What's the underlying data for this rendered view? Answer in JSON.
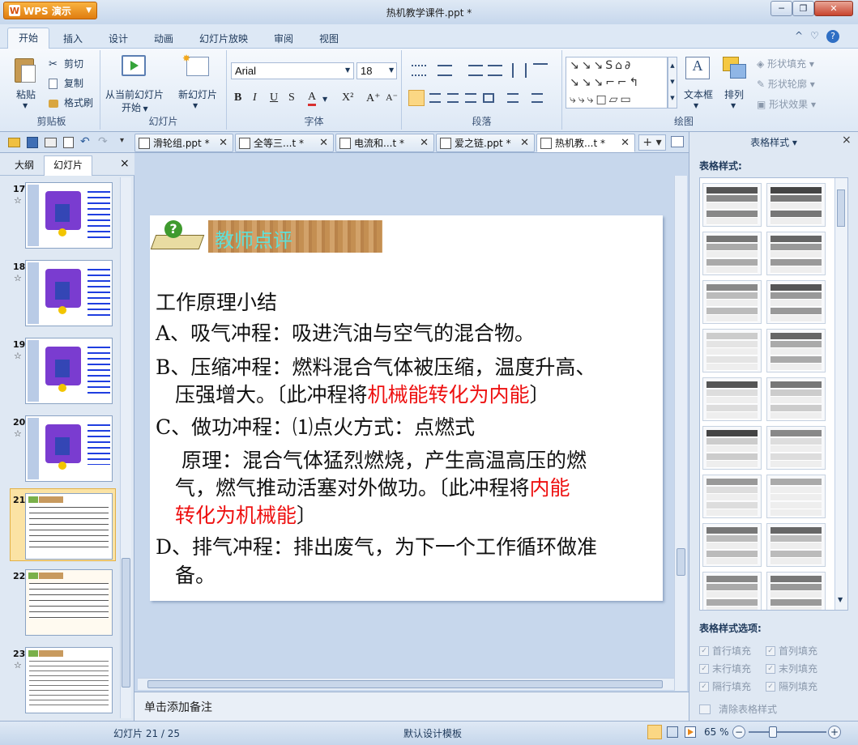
{
  "app": {
    "name": "WPS 演示",
    "title": "热机教学课件.ppt *"
  },
  "window_controls": {
    "minimize": "─",
    "restore": "❐",
    "close": "✕"
  },
  "menu": {
    "tabs": [
      "开始",
      "插入",
      "设计",
      "动画",
      "幻灯片放映",
      "审阅",
      "视图"
    ],
    "right_icons": [
      "^",
      "♡",
      "?"
    ]
  },
  "ribbon": {
    "clipboard": {
      "label": "剪贴板",
      "paste": "粘贴",
      "cut": "剪切",
      "copy": "复制",
      "format_painter": "格式刷"
    },
    "slides": {
      "label": "幻灯片",
      "from_current": "从当前幻灯片",
      "start": "开始",
      "new_slide": "新幻灯片"
    },
    "font": {
      "label": "字体",
      "family": "Arial",
      "size": "18",
      "bold": "B",
      "italic": "I",
      "underline": "U",
      "shadow": "S",
      "color": "A",
      "superscript": "X²",
      "grow": "A⁺",
      "shrink": "A⁻"
    },
    "paragraph": {
      "label": "段落"
    },
    "drawing": {
      "label": "绘图",
      "textbox": "文本框",
      "arrange": "排列",
      "shape_fill": "形状填充",
      "shape_outline": "形状轮廓",
      "shape_effect": "形状效果"
    }
  },
  "doc_tabs": [
    {
      "label": "滑轮组.ppt *"
    },
    {
      "label": "全等三...t *"
    },
    {
      "label": "电流和...t *"
    },
    {
      "label": "爱之链.ppt *"
    },
    {
      "label": "热机教...t *",
      "active": true
    }
  ],
  "left_panel": {
    "tab_outline": "大纲",
    "tab_slides": "幻灯片",
    "close": "×",
    "slides": [
      {
        "num": "17",
        "star": "☆"
      },
      {
        "num": "18",
        "star": "☆"
      },
      {
        "num": "19",
        "star": "☆"
      },
      {
        "num": "20",
        "star": "☆"
      },
      {
        "num": "21",
        "star": "",
        "selected": true
      },
      {
        "num": "22",
        "star": ""
      },
      {
        "num": "23",
        "star": "☆"
      }
    ]
  },
  "slide": {
    "header": "教师点评",
    "heading": "工作原理小结",
    "line_a": "A、吸气冲程：吸进汽油与空气的混合物。",
    "line_b1": "B、压缩冲程：燃料混合气体被压缩，温度升高、",
    "line_b2_pre": "压强增大。〔此冲程将",
    "line_b2_red": "机械能转化为内能",
    "line_b2_post": "〕",
    "line_c1": "C、做功冲程：⑴点火方式：点燃式",
    "line_c2": "原理：混合气体猛烈燃烧，产生高温高压的燃",
    "line_c3_pre": "气，燃气推动活塞对外做功。〔此冲程将",
    "line_c3_red": "内能",
    "line_c4_red": "转化为机械能",
    "line_c4_post": "〕",
    "line_d1": "D、排气冲程：排出废气，为下一个工作循环做准",
    "line_d2": "备。"
  },
  "notes": {
    "placeholder": "单击添加备注"
  },
  "right_panel": {
    "title": "表格样式",
    "styles_label": "表格样式:",
    "options_label": "表格样式选项:",
    "options": [
      "首行填充",
      "首列填充",
      "末行填充",
      "末列填充",
      "隔行填充",
      "隔列填充"
    ],
    "clear": "清除表格样式"
  },
  "status": {
    "slide_info": "幻灯片 21 / 25",
    "template": "默认设计模板",
    "zoom": "65 %"
  },
  "colors": {
    "accent": "#f28c1e",
    "red_text": "#ee1111",
    "wood": "#c89a5e"
  }
}
